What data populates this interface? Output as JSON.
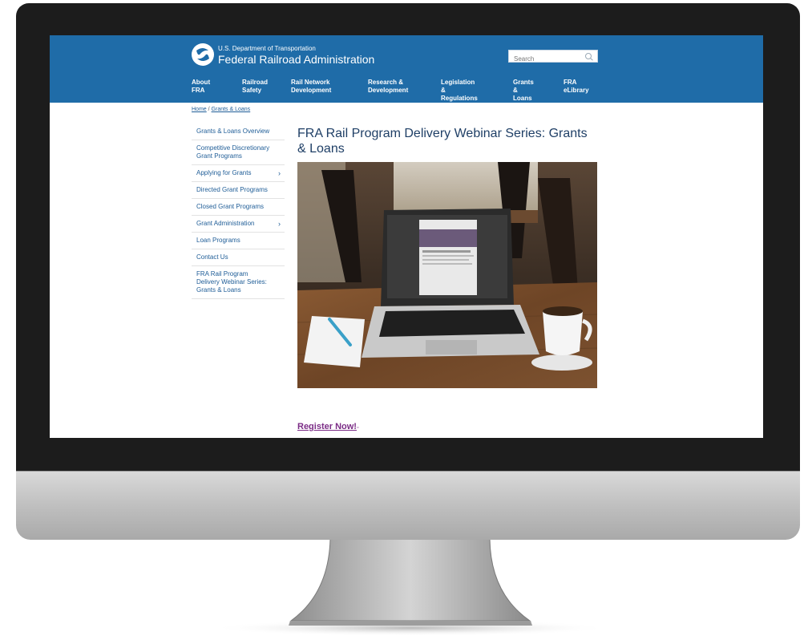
{
  "header": {
    "agency_small": "U.S. Department of Transportation",
    "agency_name": "Federal Railroad Administration",
    "search_placeholder": "Search",
    "nav": [
      {
        "label": "About\nFRA"
      },
      {
        "label": "Railroad\nSafety"
      },
      {
        "label": "Rail Network\nDevelopment"
      },
      {
        "label": "Research &\nDevelopment"
      },
      {
        "label": "Legislation &\nRegulations"
      },
      {
        "label": "Grants &\nLoans"
      },
      {
        "label": "FRA\neLibrary"
      }
    ]
  },
  "breadcrumb": {
    "home": "Home",
    "separator": "/",
    "current": "Grants & Loans"
  },
  "sidebar": {
    "items": [
      {
        "label": "Grants & Loans Overview"
      },
      {
        "label": "Competitive Discretionary Grant Programs"
      },
      {
        "label": "Applying for Grants",
        "chevron": "›"
      },
      {
        "label": "Directed Grant Programs"
      },
      {
        "label": "Closed Grant Programs"
      },
      {
        "label": "Grant Administration",
        "chevron": "›"
      },
      {
        "label": "Loan Programs"
      },
      {
        "label": "Contact Us"
      },
      {
        "label": "FRA Rail Program Delivery Webinar Series: Grants & Loans"
      }
    ]
  },
  "main": {
    "title": "FRA Rail Program Delivery Webinar Series: Grants & Loans",
    "register_link": "Register Now!",
    "external_icon": "external-link-icon"
  },
  "colors": {
    "header_blue": "#1f6ca8",
    "link_blue": "#1f5d97",
    "title_navy": "#1f3f66",
    "register_purple": "#7b2c86",
    "bezel": "#1c1c1c"
  }
}
